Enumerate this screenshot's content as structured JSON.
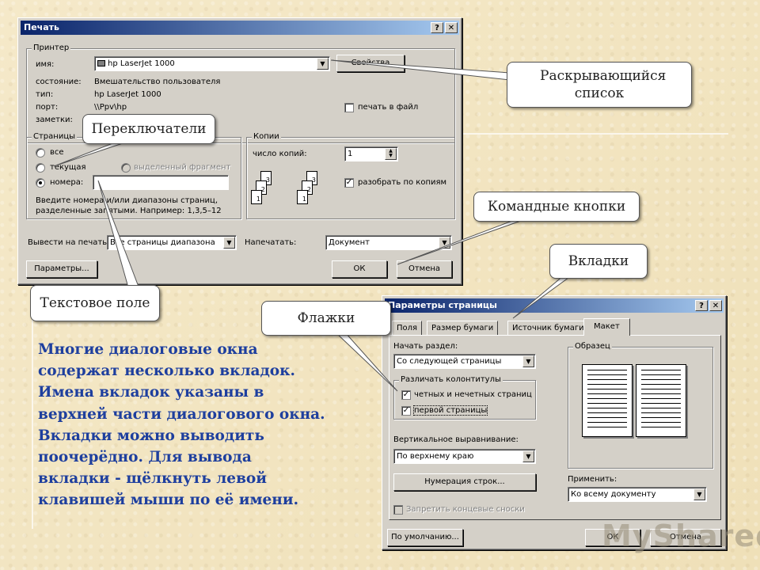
{
  "print_dialog": {
    "title": "Печать",
    "help_btn": "?",
    "close_btn": "✕",
    "printer_group": "Принтер",
    "name_label": "имя:",
    "name_value": "hp LaserJet 1000",
    "properties_btn": "Свойства",
    "status_label": "состояние:",
    "status_value": "Вмешательство пользователя",
    "type_label": "тип:",
    "type_value": "hp LaserJet 1000",
    "port_label": "порт:",
    "port_value": "\\\\Ppv\\hp",
    "notes_label": "заметки:",
    "print_to_file": "печать в файл",
    "pages_group": "Страницы",
    "radio_all": "все",
    "radio_current": "текущая",
    "radio_selection": "выделенный фрагмент",
    "radio_numbers": "номера:",
    "hint": "Введите номера и/или диапазоны страниц, разделенные запятыми. Например: 1,3,5–12",
    "copies_group": "Копии",
    "copies_label": "число копий:",
    "copies_value": "1",
    "collate": "разобрать по копиям",
    "print_what_label": "Вывести на печать:",
    "print_what_value": "Все страницы диапазона",
    "print_label": "Напечатать:",
    "print_value": "Документ",
    "params_btn": "Параметры...",
    "ok_btn": "ОК",
    "cancel_btn": "Отмена"
  },
  "page_setup": {
    "title": "Параметры страницы",
    "help_btn": "?",
    "close_btn": "✕",
    "tabs": [
      "Поля",
      "Размер бумаги",
      "Источник бумаги",
      "Макет"
    ],
    "section_start_label": "Начать раздел:",
    "section_start_value": "Со следующей страницы",
    "headers_group": "Различать колонтитулы",
    "check_odd_even": "четных и нечетных страниц",
    "check_first": "первой страницы",
    "valign_label": "Вертикальное выравнивание:",
    "valign_value": "По верхнему краю",
    "line_numbers_btn": "Нумерация строк...",
    "endnotes": "Запретить концевые сноски",
    "sample_group": "Образец",
    "apply_label": "Применить:",
    "apply_value": "Ко всему документу",
    "default_btn": "По умолчанию...",
    "ok_btn": "ОК",
    "cancel_btn": "Отмена"
  },
  "callouts": {
    "dropdown": "Раскрывающийся список",
    "switches": "Переключатели",
    "command_buttons": "Командные кнопки",
    "tabs": "Вкладки",
    "text_field": "Текстовое поле",
    "checkboxes": "Флажки"
  },
  "body_text": [
    "Многие диалоговые окна",
    "содержат несколько вкладок.",
    "Имена вкладок указаны в",
    "верхней части диалогового окна.",
    "Вкладки можно выводить",
    "поочерёдно. Для вывода",
    "вкладки - щёлкнуть левой",
    "клавишей мыши по её имени."
  ],
  "watermark": "MyShared",
  "colors": {
    "background": "#f3e6c3",
    "title_bar": "#0a246a",
    "body_text": "#1e3f9e",
    "dialog": "#d4d0c8"
  }
}
